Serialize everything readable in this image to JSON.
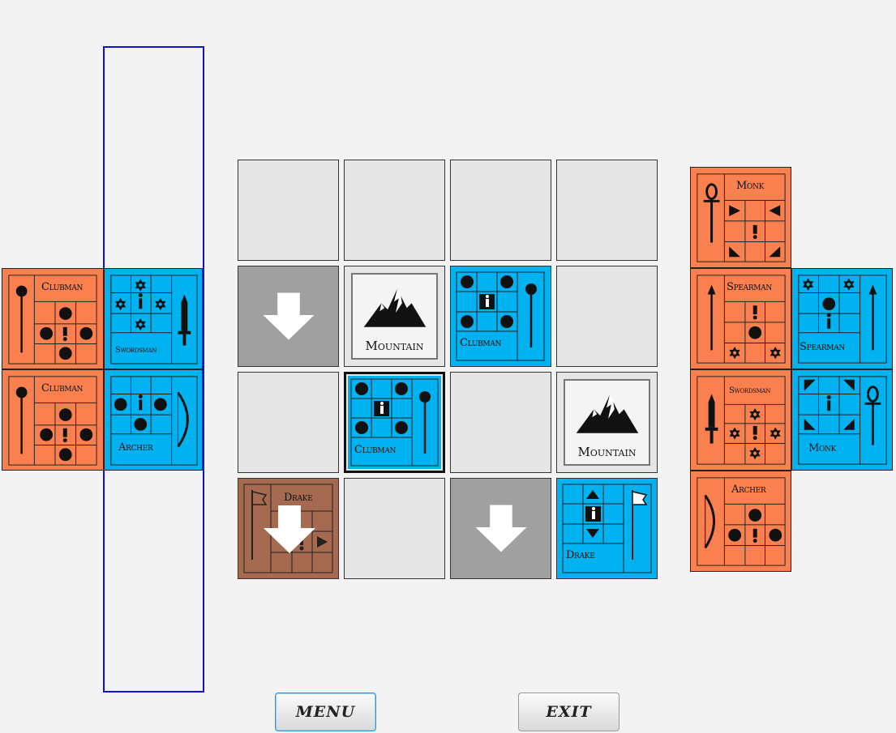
{
  "colors": {
    "orange": "#fb8050",
    "blue": "#00b2f0",
    "selection": "#1010d0",
    "cell": "#e6e6e6",
    "dark_cell": "#a0a0a0",
    "brown": "#a66a50"
  },
  "buttons": {
    "menu": "MENU",
    "exit": "EXIT"
  },
  "left_stack": [
    {
      "name": "Clubman",
      "team": "orange",
      "icon": "mace-icon"
    },
    {
      "name": "Clubman",
      "team": "orange",
      "icon": "mace-icon"
    }
  ],
  "left_active": [
    {
      "name": "Swordsman",
      "team": "blue",
      "icon": "sword-icon"
    },
    {
      "name": "Archer",
      "team": "blue",
      "icon": "bow-icon"
    }
  ],
  "board": {
    "rows": 4,
    "cols": 4,
    "pieces": {
      "mountain_1": "Mountain",
      "clubman_1": "Clubman",
      "clubman_2": "Clubman",
      "mountain_2": "Mountain",
      "drake_brown": "Drake",
      "drake_blue": "Drake"
    },
    "selected_cell": "row 3, col 2"
  },
  "right_stack": [
    {
      "name": "Monk",
      "team": "orange",
      "icon": "ankh-icon"
    },
    {
      "name": "Spearman",
      "team": "orange",
      "icon": "spear-icon"
    },
    {
      "name": "Swordsman",
      "team": "orange",
      "icon": "sword-icon"
    },
    {
      "name": "Archer",
      "team": "orange",
      "icon": "bow-icon"
    }
  ],
  "right_active": [
    {
      "name": "Spearman",
      "team": "blue",
      "icon": "spear-icon"
    },
    {
      "name": "Monk",
      "team": "blue",
      "icon": "ankh-icon"
    }
  ]
}
